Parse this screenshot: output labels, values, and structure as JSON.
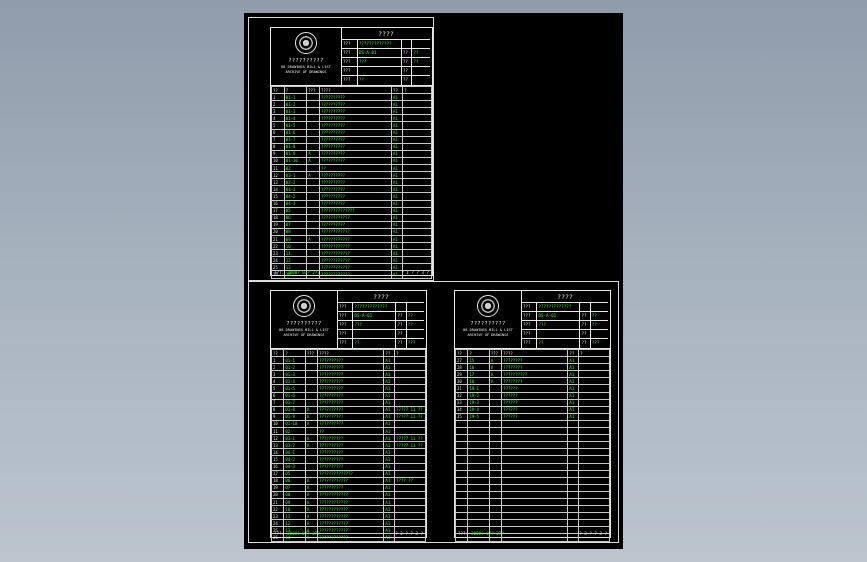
{
  "colors": {
    "background": "#000000",
    "line": "#e8e8e8",
    "data_text": "#33ff33",
    "label_text": "#f0f0f0"
  },
  "sheets": [
    {
      "id": "sheet-1",
      "title": "????",
      "org": [
        "??????????",
        "88 DRAWINGS BILL & LIST",
        "ARCHIVE OF DRAWINGS"
      ],
      "tb_rows": [
        {
          "l": "???",
          "v": "?????????????",
          "l2": "",
          "v2": ""
        },
        {
          "l": "???",
          "v": "DS-A-01",
          "l2": "??",
          "v2": "??"
        },
        {
          "l": "???",
          "v": "???",
          "l2": "??",
          "v2": "??"
        },
        {
          "l": "???",
          "v": "",
          "l2": "??",
          "v2": ""
        },
        {
          "l": "???",
          "v": "??",
          "l2": "??",
          "v2": ""
        }
      ],
      "header": [
        "??",
        "?",
        "???",
        "????",
        "??",
        "?"
      ],
      "rows": [
        [
          "1",
          "01-1",
          "",
          "??????????",
          "A1",
          ""
        ],
        [
          "2",
          "01-2",
          "",
          "??????????",
          "A1",
          ""
        ],
        [
          "3",
          "01-3",
          "",
          "??????????",
          "A1",
          ""
        ],
        [
          "4",
          "01-4",
          "",
          "??????????",
          "A1",
          ""
        ],
        [
          "5",
          "01-5",
          "",
          "??????????",
          "A1",
          ""
        ],
        [
          "6",
          "01-6",
          "",
          "??????????",
          "A1",
          ""
        ],
        [
          "7",
          "01-7",
          "",
          "??????????",
          "A1",
          ""
        ],
        [
          "8",
          "01-8",
          "",
          "??????????",
          "A1",
          ""
        ],
        [
          "9",
          "01-9",
          "A",
          "??????????",
          "A1",
          ""
        ],
        [
          "10",
          "01-10",
          "A",
          "??????????",
          "A1",
          ""
        ],
        [
          "11",
          "02",
          "",
          "??",
          "A1",
          ""
        ],
        [
          "12",
          "03-1",
          "A",
          "??????????",
          "A1",
          ""
        ],
        [
          "13",
          "03-2",
          "",
          "??????????",
          "A1",
          ""
        ],
        [
          "14",
          "04-1",
          "",
          "??????????",
          "A1",
          ""
        ],
        [
          "15",
          "04-2",
          "",
          "??????????",
          "A1",
          ""
        ],
        [
          "16",
          "04-3",
          "",
          "??????????",
          "A1",
          ""
        ],
        [
          "17",
          "05",
          "",
          "??????????????",
          "A1",
          ""
        ],
        [
          "18",
          "06",
          "",
          "????????????",
          "A1",
          ""
        ],
        [
          "19",
          "07",
          "",
          "??????????",
          "A1",
          ""
        ],
        [
          "20",
          "08",
          "",
          "????????????",
          "A1",
          ""
        ],
        [
          "21",
          "09",
          "A",
          "????????????",
          "A1",
          ""
        ],
        [
          "22",
          "10",
          "",
          "????????????",
          "A1",
          ""
        ],
        [
          "23",
          "11",
          "",
          "????????????",
          "A1",
          ""
        ],
        [
          "24",
          "12",
          "",
          "????????????",
          "A1",
          ""
        ],
        [
          "25",
          "13",
          "",
          "????????????",
          "A1",
          ""
        ],
        [
          "26",
          "14",
          "",
          "????????????",
          "A1",
          ""
        ]
      ],
      "footer_label": "???:",
      "footer_date": "2008? 07? 27?",
      "footer_page": "? 1 ? ? 3 ?"
    },
    {
      "id": "sheet-2",
      "title": "????",
      "org": [
        "??????????",
        "88 DRAWINGS BILL & LIST",
        "ARCHIVE OF DRAWINGS"
      ],
      "tb_rows": [
        {
          "l": "???",
          "v": "?????????????",
          "l2": "",
          "v2": ""
        },
        {
          "l": "???",
          "v": "DS-A-01",
          "l2": "??",
          "v2": "??"
        },
        {
          "l": "???",
          "v": "???",
          "l2": "??",
          "v2": "??"
        },
        {
          "l": "???",
          "v": "",
          "l2": "??",
          "v2": ""
        },
        {
          "l": "???",
          "v": "??",
          "l2": "??",
          "v2": "???"
        }
      ],
      "header": [
        "??",
        "?",
        "???",
        "????",
        "??",
        "?"
      ],
      "rows": [
        [
          "1",
          "01-1",
          "",
          "??????????",
          "A1",
          ""
        ],
        [
          "2",
          "01-2",
          "",
          "??????????",
          "A1",
          ""
        ],
        [
          "3",
          "01-3",
          "",
          "??????????",
          "A1",
          ""
        ],
        [
          "4",
          "01-4",
          "",
          "??????????",
          "A1",
          ""
        ],
        [
          "5",
          "01-5",
          "",
          "??????????",
          "A1",
          ""
        ],
        [
          "6",
          "01-6",
          "",
          "??????????",
          "A1",
          ""
        ],
        [
          "7",
          "01-7",
          "",
          "??????????",
          "A1",
          ""
        ],
        [
          "8",
          "01-8",
          "A",
          "??????????",
          "A1",
          "????7 11 ??"
        ],
        [
          "9",
          "01-9",
          "A",
          "??????????",
          "A1",
          "????7 11 ??"
        ],
        [
          "10",
          "01-10",
          "A",
          "??????????",
          "A1",
          ""
        ],
        [
          "11",
          "02",
          "",
          "??",
          "A1",
          ""
        ],
        [
          "12",
          "03-1",
          "A",
          "??????????",
          "A1",
          "????7 11 ??"
        ],
        [
          "13",
          "03-2",
          "A",
          "??????????",
          "A1",
          "????7 11 ??"
        ],
        [
          "14",
          "04-1",
          "",
          "??????????",
          "A1",
          ""
        ],
        [
          "15",
          "04-2",
          "",
          "??????????",
          "A1",
          ""
        ],
        [
          "16",
          "04-3",
          "",
          "??????????",
          "A1",
          ""
        ],
        [
          "17",
          "05",
          "",
          "??????????????",
          "A1",
          ""
        ],
        [
          "18",
          "06",
          "A",
          "????????????",
          "A1",
          "???? ??"
        ],
        [
          "19",
          "07",
          "A",
          "??????????",
          "A1",
          ""
        ],
        [
          "20",
          "08",
          "A",
          "????????????",
          "A1",
          ""
        ],
        [
          "21",
          "09",
          "A",
          "????????????",
          "A1",
          ""
        ],
        [
          "22",
          "10",
          "A",
          "????????????",
          "A1",
          ""
        ],
        [
          "23",
          "11",
          "A",
          "????????????",
          "A1",
          ""
        ],
        [
          "24",
          "12",
          "A",
          "????????????",
          "A1",
          ""
        ],
        [
          "25",
          "13",
          "A",
          "????????????",
          "A1",
          ""
        ],
        [
          "26",
          "14",
          "A",
          "????????????",
          "A1",
          ""
        ]
      ],
      "footer_label": "???:",
      "footer_date": "2008? 07? 27?",
      "footer_page": "? 2 ? ? 3 ?"
    },
    {
      "id": "sheet-3",
      "title": "????",
      "org": [
        "??????????",
        "88 DRAWINGS BILL & LIST",
        "ARCHIVE OF DRAWINGS"
      ],
      "tb_rows": [
        {
          "l": "???",
          "v": "?????????????",
          "l2": "",
          "v2": ""
        },
        {
          "l": "???",
          "v": "DS-A-01",
          "l2": "??",
          "v2": "??"
        },
        {
          "l": "???",
          "v": "???",
          "l2": "??",
          "v2": "??"
        },
        {
          "l": "???",
          "v": "",
          "l2": "??",
          "v2": ""
        },
        {
          "l": "???",
          "v": "??",
          "l2": "??",
          "v2": "???"
        }
      ],
      "header": [
        "??",
        "?",
        "???",
        "????",
        "??",
        "?"
      ],
      "rows": [
        [
          "27",
          "15",
          "A",
          "????????",
          "A1",
          ""
        ],
        [
          "28",
          "16",
          "A",
          "????????",
          "A1",
          ""
        ],
        [
          "29",
          "17",
          "A",
          "??????????",
          "A1",
          ""
        ],
        [
          "30",
          "18",
          "A",
          "????????",
          "A1",
          ""
        ],
        [
          "31",
          "19-1",
          "",
          "??????",
          "A1",
          ""
        ],
        [
          "32",
          "19-2",
          "",
          "??????",
          "A1",
          ""
        ],
        [
          "33",
          "19-3",
          "",
          "??????",
          "A1",
          ""
        ],
        [
          "34",
          "19-4",
          "",
          "??????",
          "A1",
          ""
        ],
        [
          "35",
          "19-5",
          "",
          "??????",
          "A1",
          ""
        ],
        [
          "",
          "",
          "",
          "",
          "",
          ""
        ],
        [
          "",
          "",
          "",
          "",
          "",
          ""
        ],
        [
          "",
          "",
          "",
          "",
          "",
          ""
        ],
        [
          "",
          "",
          "",
          "",
          "",
          ""
        ],
        [
          "",
          "",
          "",
          "",
          "",
          ""
        ],
        [
          "",
          "",
          "",
          "",
          "",
          ""
        ],
        [
          "",
          "",
          "",
          "",
          "",
          ""
        ],
        [
          "",
          "",
          "",
          "",
          "",
          ""
        ],
        [
          "",
          "",
          "",
          "",
          "",
          ""
        ],
        [
          "",
          "",
          "",
          "",
          "",
          ""
        ],
        [
          "",
          "",
          "",
          "",
          "",
          ""
        ],
        [
          "",
          "",
          "",
          "",
          "",
          ""
        ],
        [
          "",
          "",
          "",
          "",
          "",
          ""
        ],
        [
          "",
          "",
          "",
          "",
          "",
          ""
        ],
        [
          "",
          "",
          "",
          "",
          "",
          ""
        ],
        [
          "",
          "",
          "",
          "",
          "",
          ""
        ],
        [
          "",
          "",
          "",
          "",
          "",
          ""
        ]
      ],
      "footer_label": "???:",
      "footer_date": "2008? 07? 27?",
      "footer_page": "? 3 ? ? 3 ?"
    }
  ]
}
